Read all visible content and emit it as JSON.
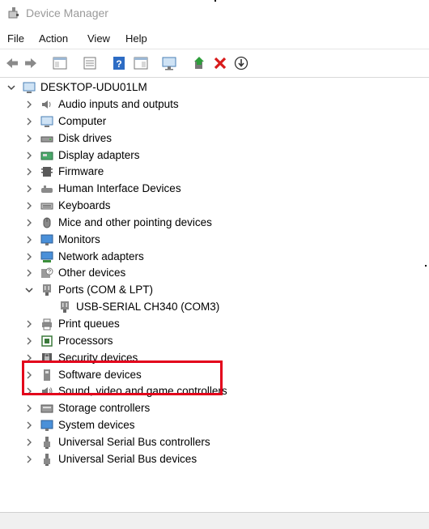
{
  "window": {
    "title": "Device Manager"
  },
  "menu": [
    "File",
    "Action",
    "View",
    "Help"
  ],
  "toolbar": [
    "back-icon",
    "forward-icon",
    "show-hide-console-tree-icon",
    "properties-icon",
    "help-icon",
    "action-pane-icon",
    "scan-hardware-icon",
    "update-driver-icon",
    "uninstall-icon",
    "disable-device-icon"
  ],
  "tree": {
    "root": "DESKTOP-UDU01LM",
    "categories": [
      {
        "label": "Audio inputs and outputs",
        "icon": "speaker-icon"
      },
      {
        "label": "Computer",
        "icon": "computer-icon"
      },
      {
        "label": "Disk drives",
        "icon": "disk-drive-icon"
      },
      {
        "label": "Display adapters",
        "icon": "display-adapter-icon"
      },
      {
        "label": "Firmware",
        "icon": "firmware-icon"
      },
      {
        "label": "Human Interface Devices",
        "icon": "hid-icon"
      },
      {
        "label": "Keyboards",
        "icon": "keyboard-icon"
      },
      {
        "label": "Mice and other pointing devices",
        "icon": "mouse-icon"
      },
      {
        "label": "Monitors",
        "icon": "monitor-icon"
      },
      {
        "label": "Network adapters",
        "icon": "network-adapter-icon"
      },
      {
        "label": "Other devices",
        "icon": "unknown-device-icon"
      },
      {
        "label": "Ports (COM & LPT)",
        "icon": "port-icon",
        "expanded": true,
        "children": [
          {
            "label": "USB-SERIAL CH340 (COM3)",
            "icon": "port-icon"
          }
        ]
      },
      {
        "label": "Print queues",
        "icon": "printer-icon"
      },
      {
        "label": "Processors",
        "icon": "processor-icon"
      },
      {
        "label": "Security devices",
        "icon": "security-device-icon"
      },
      {
        "label": "Software devices",
        "icon": "software-device-icon"
      },
      {
        "label": "Sound, video and game controllers",
        "icon": "sound-icon"
      },
      {
        "label": "Storage controllers",
        "icon": "storage-controller-icon"
      },
      {
        "label": "System devices",
        "icon": "system-device-icon"
      },
      {
        "label": "Universal Serial Bus controllers",
        "icon": "usb-icon"
      },
      {
        "label": "Universal Serial Bus devices",
        "icon": "usb-icon"
      }
    ]
  },
  "colors": {
    "highlight": "#e3001b",
    "disabled_title": "#9a9a9a",
    "toolbar_green": "#2e9e3b",
    "toolbar_blue": "#2d6cc4"
  }
}
